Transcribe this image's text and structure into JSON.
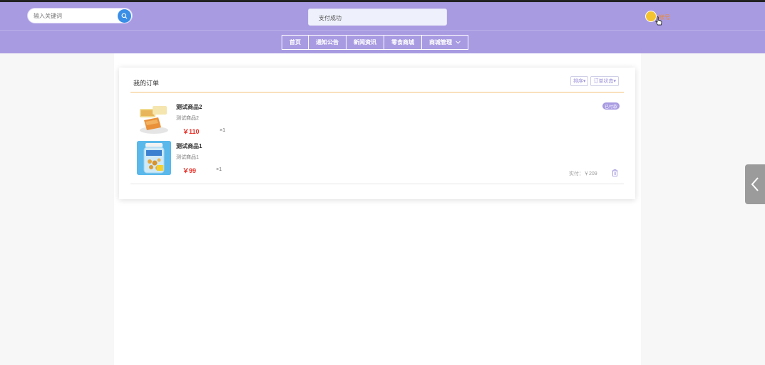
{
  "header": {
    "search": {
      "placeholder": "输入关键词",
      "icon": "search-icon"
    },
    "toast": "支付成功",
    "user": {
      "name": "帐号",
      "avatar_icon": "avatar-icon"
    }
  },
  "nav": {
    "items": [
      {
        "label": "首页"
      },
      {
        "label": "通知公告"
      },
      {
        "label": "新闻资讯"
      },
      {
        "label": "零食商城"
      },
      {
        "label": "商城管理",
        "dropdown": true
      }
    ]
  },
  "orders": {
    "title": "我的订单",
    "sort_label": "排序",
    "status_filter_label": "订单状态",
    "order": {
      "status": "已付款",
      "pay_label": "实付：￥209",
      "items": [
        {
          "name": "测试商品2",
          "desc": "测试商品2",
          "price": "￥110",
          "qty": "×1"
        },
        {
          "name": "测试商品1",
          "desc": "测试商品1",
          "price": "￥99",
          "qty": "×1"
        }
      ]
    }
  },
  "colors": {
    "header_bg": "#a99be2",
    "price": "#e8322a",
    "accent_divider": "#f3c27a",
    "search_button": "#3a8ee6"
  }
}
